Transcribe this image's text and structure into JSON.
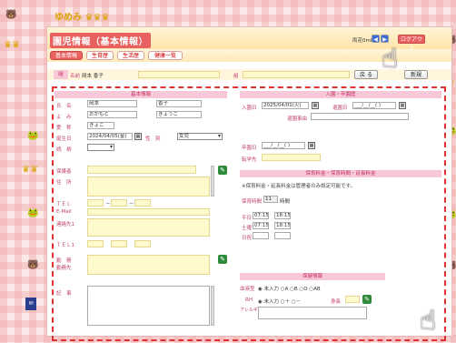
{
  "header": {
    "logo": "ゆめみ ♛♛♛",
    "title": "園児情報（基本情報）",
    "status": "両花0ml",
    "nav_prev": "◀",
    "nav_next": "▶",
    "right_button": "ログアウト"
  },
  "tabs": [
    {
      "label": "基本情報",
      "active": true
    },
    {
      "label": "生育歴"
    },
    {
      "label": "生活歴"
    },
    {
      "label": "健康一覧"
    }
  ],
  "search": {
    "class_label": "組",
    "name_label": "名前",
    "name_value": "岡本 香子",
    "class_value": "",
    "group_label": "組",
    "return_label": "戻 る",
    "save_label": "新規"
  },
  "basic": {
    "heading": "基本情報",
    "name_label": "氏　名",
    "name_last": "岡本",
    "name_first": "香子",
    "kana_label": "よ　み",
    "kana_last": "おかもと",
    "kana_first": "きょうこ",
    "nick_label": "愛　称",
    "nick_value": "きょこ",
    "birth_label": "誕生日",
    "birth_value": "2024/04/05(金)",
    "sex_label": "性　別",
    "sex_value": "女児",
    "blood_label": "続　柄",
    "blood_value": "",
    "guardian_label": "保護者",
    "address_label": "住　所",
    "tel_label": "ＴＥＬ",
    "tel_dash1": "－",
    "tel_dash2": "－",
    "email_label": "E-Mail",
    "contact_label": "連絡先1",
    "tel1_label": "ＴＥＬ1",
    "work_label": "勤　務",
    "work_label2": "勤務先",
    "note_label": "記　事"
  },
  "enroll": {
    "heading": "入園・卒園歴",
    "enter_label": "入園日",
    "enter_value": "2025/04/01(火)",
    "leave_label": "退園日",
    "leave_value": "___/__/__(  )",
    "reason_label": "退園事由",
    "move_label": "卒園日",
    "move_value": "___/__/__(  )",
    "dest_label": "転学先"
  },
  "care": {
    "heading": "保育料金・保育時間・延長料金",
    "note": "※保育料金・延長料金は管理者のみ設定可能です。",
    "hours_label": "保育時間",
    "hours_value": "11",
    "hours_unit": "時間",
    "weekday_label": "平日",
    "weekday_from": "07:15",
    "weekday_to": "18:15",
    "sat_label": "土曜",
    "sat_from": "07:15",
    "sat_to": "18:15",
    "hol_label": "日祝",
    "hol_from": "",
    "hol_to": ""
  },
  "health": {
    "heading": "保健情報",
    "blood_label": "血液型",
    "blood_options": "◉ 未入力 ○A ○B ○O ○AB",
    "rh_label": "RH",
    "rh_options": "◉ 未入力 ○＋ ○－",
    "height_label": "身長",
    "allergy_label": "アレルギー"
  },
  "colors": {
    "accent": "#e86060",
    "pink": "#f8c8d8",
    "yellow": "#fffacc",
    "dashed": "#e03030"
  }
}
